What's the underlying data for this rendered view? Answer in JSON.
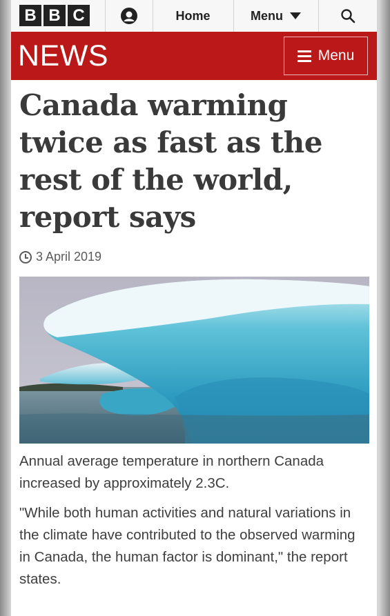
{
  "bbc_header": {
    "logo_letters": [
      "B",
      "B",
      "C"
    ],
    "nav_home": "Home",
    "nav_menu": "Menu",
    "icons": [
      "account-icon",
      "chevron-down-icon",
      "search-icon"
    ]
  },
  "news_header": {
    "brand": "NEWS",
    "menu_label": "Menu",
    "brand_color": "#bb1919"
  },
  "article": {
    "headline": "Canada warming twice as fast as the rest of the world, report says",
    "date": "3 April 2019",
    "image_caption": "Annual average temperature in northern Canada increased by approximately 2.3C.",
    "paragraph": "\"While both human activities and natural variations in the climate have contributed to the observed warming in Canada, the human factor is dominant,\" the report states."
  }
}
